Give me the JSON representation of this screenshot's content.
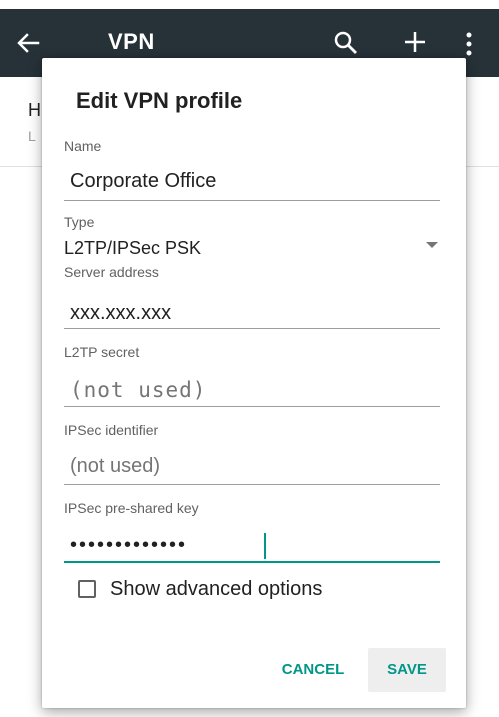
{
  "app_bar": {
    "title": "VPN",
    "icons": [
      "back-arrow-icon",
      "search-icon",
      "plus-icon",
      "more-vert-icon"
    ]
  },
  "background_row": {
    "line1": "H",
    "line2": "L"
  },
  "dialog": {
    "title": "Edit VPN profile",
    "name_label": "Name",
    "name_value": "Corporate Office",
    "type_label": "Type",
    "type_value": "L2TP/IPSec PSK",
    "server_label": "Server address",
    "server_value": "xxx.xxx.xxx",
    "l2tp_label": "L2TP secret",
    "l2tp_value": "(not used)",
    "ipsec_id_label": "IPSec identifier",
    "ipsec_id_value": "(not used)",
    "psk_label": "IPSec pre-shared key",
    "psk_value": "•••••••••••••",
    "advanced_label": "Show advanced options",
    "advanced_checked": false,
    "cancel_label": "CANCEL",
    "save_label": "SAVE"
  },
  "colors": {
    "app_bar": "#263238",
    "accent": "#009688"
  }
}
